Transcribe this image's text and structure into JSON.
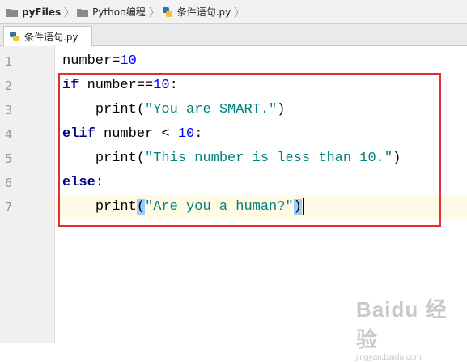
{
  "breadcrumb": {
    "items": [
      {
        "label": "pyFiles",
        "icon": "folder-icon"
      },
      {
        "label": "Python编程",
        "icon": "folder-icon"
      },
      {
        "label": "条件语句.py",
        "icon": "python-file-icon"
      }
    ]
  },
  "tabs": [
    {
      "label": "条件语句.py",
      "icon": "python-file-icon",
      "active": true
    }
  ],
  "editor": {
    "line_numbers": [
      "1",
      "2",
      "3",
      "4",
      "5",
      "6",
      "7"
    ],
    "current_line": 7,
    "code": {
      "line1": {
        "name": "number",
        "op": "=",
        "val": "10"
      },
      "line2": {
        "kw": "if",
        "name": " number",
        "op": "==",
        "val": "10",
        "colon": ":"
      },
      "line3": {
        "indent": "    ",
        "func": "print",
        "open": "(",
        "str": "\"You are SMART.\"",
        "close": ")"
      },
      "line4": {
        "kw": "elif",
        "name": " number",
        "op": " < ",
        "val": "10",
        "colon": ":"
      },
      "line5": {
        "indent": "    ",
        "func": "print",
        "open": "(",
        "str": "\"This number is less than 10.\"",
        "close": ")"
      },
      "line6": {
        "kw": "else",
        "colon": ":"
      },
      "line7": {
        "indent": "    ",
        "func": "print",
        "open": "(",
        "str": "\"Are you a human?\"",
        "close": ")"
      }
    }
  },
  "watermark": {
    "main": "Baidu 经验",
    "sub": "jingyan.baidu.com"
  },
  "colors": {
    "keyword": "#000080",
    "number": "#0000ff",
    "string": "#008080",
    "highlight_box": "#e03030",
    "caret_line": "#fffae3"
  }
}
